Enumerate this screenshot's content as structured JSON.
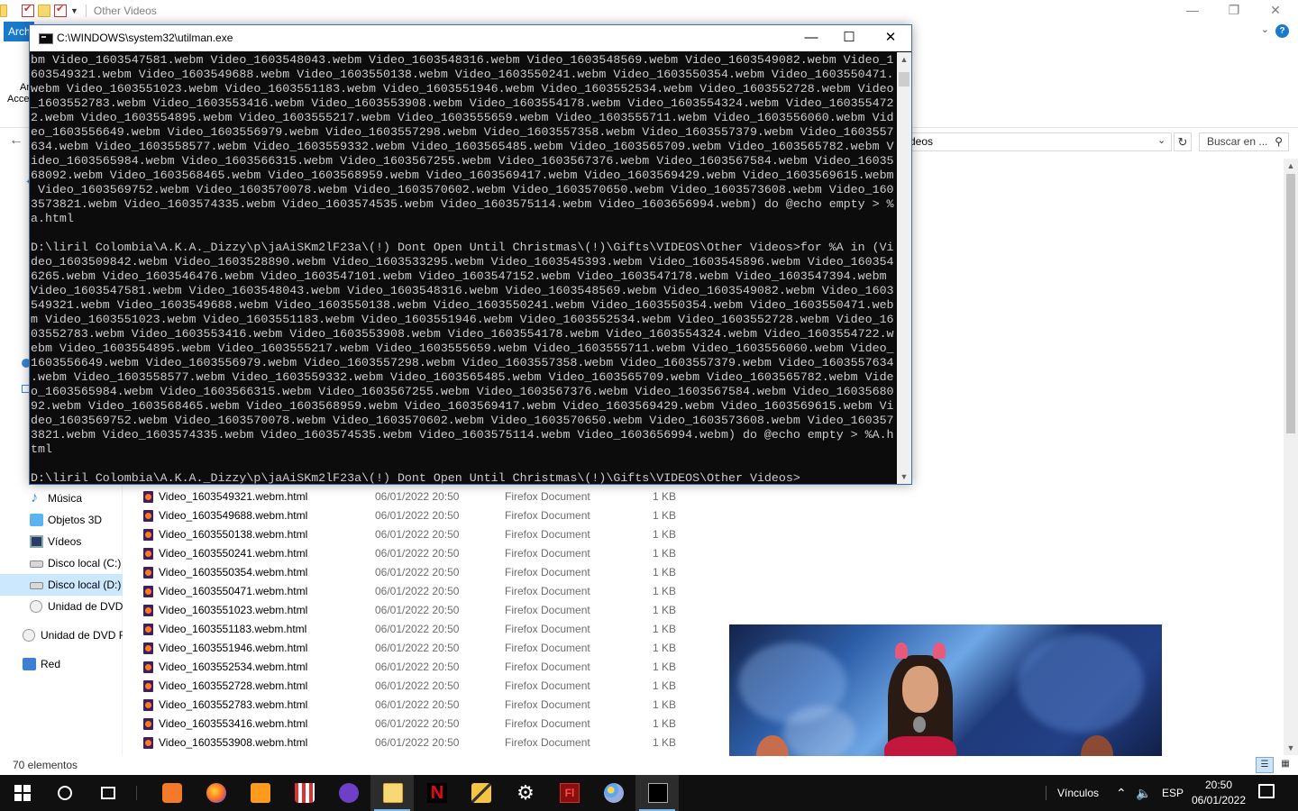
{
  "explorer": {
    "title": "Other Videos",
    "file_tab": "Archivo",
    "ribbon_fragments": [
      "An",
      "Acces"
    ],
    "address_fragment": "deos",
    "search_placeholder": "Buscar en ...",
    "status_count": "70 elementos",
    "sidebar": [
      {
        "label": "Música",
        "icon": "music-icon"
      },
      {
        "label": "Objetos 3D",
        "icon": "3d-objects-icon"
      },
      {
        "label": "Vídeos",
        "icon": "videos-icon"
      },
      {
        "label": "Disco local (C:)",
        "icon": "drive-icon"
      },
      {
        "label": "Disco local (D:)",
        "icon": "drive-icon",
        "selected": true
      },
      {
        "label": "Unidad de DVD",
        "icon": "dvd-icon"
      },
      {
        "label": "Unidad de DVD R",
        "icon": "dvd-icon"
      },
      {
        "label": "Red",
        "icon": "network-icon"
      }
    ],
    "files": [
      {
        "name": "Video_1603549321.webm.html",
        "date": "06/01/2022 20:50",
        "type": "Firefox Document",
        "size": "1 KB"
      },
      {
        "name": "Video_1603549688.webm.html",
        "date": "06/01/2022 20:50",
        "type": "Firefox Document",
        "size": "1 KB"
      },
      {
        "name": "Video_1603550138.webm.html",
        "date": "06/01/2022 20:50",
        "type": "Firefox Document",
        "size": "1 KB"
      },
      {
        "name": "Video_1603550241.webm.html",
        "date": "06/01/2022 20:50",
        "type": "Firefox Document",
        "size": "1 KB"
      },
      {
        "name": "Video_1603550354.webm.html",
        "date": "06/01/2022 20:50",
        "type": "Firefox Document",
        "size": "1 KB"
      },
      {
        "name": "Video_1603550471.webm.html",
        "date": "06/01/2022 20:50",
        "type": "Firefox Document",
        "size": "1 KB"
      },
      {
        "name": "Video_1603551023.webm.html",
        "date": "06/01/2022 20:50",
        "type": "Firefox Document",
        "size": "1 KB"
      },
      {
        "name": "Video_1603551183.webm.html",
        "date": "06/01/2022 20:50",
        "type": "Firefox Document",
        "size": "1 KB"
      },
      {
        "name": "Video_1603551946.webm.html",
        "date": "06/01/2022 20:50",
        "type": "Firefox Document",
        "size": "1 KB"
      },
      {
        "name": "Video_1603552534.webm.html",
        "date": "06/01/2022 20:50",
        "type": "Firefox Document",
        "size": "1 KB"
      },
      {
        "name": "Video_1603552728.webm.html",
        "date": "06/01/2022 20:50",
        "type": "Firefox Document",
        "size": "1 KB"
      },
      {
        "name": "Video_1603552783.webm.html",
        "date": "06/01/2022 20:50",
        "type": "Firefox Document",
        "size": "1 KB"
      },
      {
        "name": "Video_1603553416.webm.html",
        "date": "06/01/2022 20:50",
        "type": "Firefox Document",
        "size": "1 KB"
      },
      {
        "name": "Video_1603553908.webm.html",
        "date": "06/01/2022 20:50",
        "type": "Firefox Document",
        "size": "1 KB"
      }
    ]
  },
  "console": {
    "title": "C:\\WINDOWS\\system32\\utilman.exe",
    "lines": [
      "bm Video_1603547581.webm Video_1603548043.webm Video_1603548316.webm Video_1603548569.webm Video_1603549082.webm Video_1",
      "603549321.webm Video_1603549688.webm Video_1603550138.webm Video_1603550241.webm Video_1603550354.webm Video_1603550471.",
      "webm Video_1603551023.webm Video_1603551183.webm Video_1603551946.webm Video_1603552534.webm Video_1603552728.webm Video",
      "_1603552783.webm Video_1603553416.webm Video_1603553908.webm Video_1603554178.webm Video_1603554324.webm Video_160355472",
      "2.webm Video_1603554895.webm Video_1603555217.webm Video_1603555659.webm Video_1603555711.webm Video_1603556060.webm Vid",
      "eo_1603556649.webm Video_1603556979.webm Video_1603557298.webm Video_1603557358.webm Video_1603557379.webm Video_1603557",
      "634.webm Video_1603558577.webm Video_1603559332.webm Video_1603565485.webm Video_1603565709.webm Video_1603565782.webm V",
      "ideo_1603565984.webm Video_1603566315.webm Video_1603567255.webm Video_1603567376.webm Video_1603567584.webm Video_16035",
      "68092.webm Video_1603568465.webm Video_1603568959.webm Video_1603569417.webm Video_1603569429.webm Video_1603569615.webm",
      " Video_1603569752.webm Video_1603570078.webm Video_1603570602.webm Video_1603570650.webm Video_1603573608.webm Video_160",
      "3573821.webm Video_1603574335.webm Video_1603574535.webm Video_1603575114.webm Video_1603656994.webm) do @echo empty > %",
      "a.html",
      "",
      "D:\\liril Colombia\\A.K.A._Dizzy\\p\\jaAiSKm2lF23a\\(!) Dont Open Until Christmas\\(!)\\Gifts\\VIDEOS\\Other Videos>for %A in (Vi",
      "deo_1603509842.webm Video_1603528890.webm Video_1603533295.webm Video_1603545393.webm Video_1603545896.webm Video_160354",
      "6265.webm Video_1603546476.webm Video_1603547101.webm Video_1603547152.webm Video_1603547178.webm Video_1603547394.webm ",
      "Video_1603547581.webm Video_1603548043.webm Video_1603548316.webm Video_1603548569.webm Video_1603549082.webm Video_1603",
      "549321.webm Video_1603549688.webm Video_1603550138.webm Video_1603550241.webm Video_1603550354.webm Video_1603550471.web",
      "m Video_1603551023.webm Video_1603551183.webm Video_1603551946.webm Video_1603552534.webm Video_1603552728.webm Video_16",
      "03552783.webm Video_1603553416.webm Video_1603553908.webm Video_1603554178.webm Video_1603554324.webm Video_1603554722.w",
      "ebm Video_1603554895.webm Video_1603555217.webm Video_1603555659.webm Video_1603555711.webm Video_1603556060.webm Video_",
      "1603556649.webm Video_1603556979.webm Video_1603557298.webm Video_1603557358.webm Video_1603557379.webm Video_1603557634",
      ".webm Video_1603558577.webm Video_1603559332.webm Video_1603565485.webm Video_1603565709.webm Video_1603565782.webm Vide",
      "o_1603565984.webm Video_1603566315.webm Video_1603567255.webm Video_1603567376.webm Video_1603567584.webm Video_16035680",
      "92.webm Video_1603568465.webm Video_1603568959.webm Video_1603569417.webm Video_1603569429.webm Video_1603569615.webm Vi",
      "deo_1603569752.webm Video_1603570078.webm Video_1603570602.webm Video_1603570650.webm Video_1603573608.webm Video_160357",
      "3821.webm Video_1603574335.webm Video_1603574535.webm Video_1603575114.webm Video_1603656994.webm) do @echo empty > %A.h",
      "tml",
      "",
      "D:\\liril Colombia\\A.K.A._Dizzy\\p\\jaAiSKm2lF23a\\(!) Dont Open Until Christmas\\(!)\\Gifts\\VIDEOS\\Other Videos>"
    ]
  },
  "taskbar": {
    "apps": [
      "windows-start-icon",
      "search-icon",
      "task-view-icon",
      "app-orange-icon",
      "firefox-icon",
      "sublime-text-icon",
      "popcorn-icon",
      "github-icon",
      "file-explorer-icon",
      "netflix-icon",
      "pencil-app-icon",
      "settings-icon",
      "flash-icon",
      "paint-icon",
      "cmd-icon"
    ],
    "links_label": "Vínculos",
    "language": "ESP",
    "time": "20:50",
    "date": "06/01/2022"
  },
  "colors": {
    "accent": "#1979ca",
    "console_bg": "#0c0c0c",
    "console_text": "#cccccc",
    "taskbar": "#101010",
    "selected": "#cce8ff"
  }
}
